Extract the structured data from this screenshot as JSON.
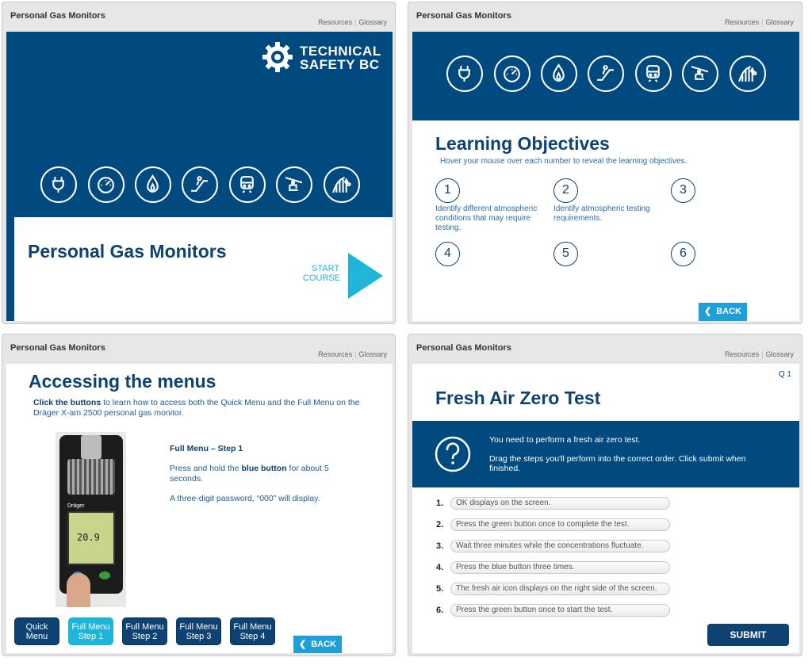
{
  "common": {
    "course_title": "Personal Gas Monitors",
    "resources": "Resources",
    "glossary": "Glossary",
    "separator": "|"
  },
  "panel1": {
    "logo_line1": "TECHNICAL",
    "logo_line2": "SAFETY BC",
    "heading": "Personal Gas Monitors",
    "start_line1": "START",
    "start_line2": "COURSE"
  },
  "icons": [
    "electrical-plug-icon",
    "pressure-gauge-icon",
    "gas-flame-icon",
    "escalator-icon",
    "railway-icon",
    "ski-lift-icon",
    "amusement-ride-icon"
  ],
  "panel2": {
    "heading": "Learning Objectives",
    "instructions": "Hover your mouse over each number to reveal the learning objectives.",
    "objectives": [
      {
        "num": "1",
        "text": "Identify different atmospheric conditions that may require testing."
      },
      {
        "num": "2",
        "text": "Identify atmospheric testing requirements."
      },
      {
        "num": "3",
        "text": ""
      },
      {
        "num": "4",
        "text": ""
      },
      {
        "num": "5",
        "text": ""
      },
      {
        "num": "6",
        "text": ""
      }
    ],
    "back_label": "BACK"
  },
  "panel3": {
    "heading": "Accessing the menus",
    "intro_bold": "Click the buttons",
    "intro_rest": " to learn how to access both the Quick Menu and the Full Menu on the Dräger X-am 2500 personal gas monitor.",
    "step_title": "Full Menu – Step 1",
    "step_p1_a": "Press and hold the ",
    "step_p1_bold": "blue button",
    "step_p1_b": " for about 5 seconds.",
    "step_p2": "A three-digit password, “000” will display.",
    "device_reading": "20.9",
    "device_brand": "Dräger",
    "buttons": [
      {
        "line1": "Quick",
        "line2": "Menu"
      },
      {
        "line1": "Full Menu",
        "line2": "Step 1"
      },
      {
        "line1": "Full Menu",
        "line2": "Step 2"
      },
      {
        "line1": "Full Menu",
        "line2": "Step 3"
      },
      {
        "line1": "Full Menu",
        "line2": "Step 4"
      }
    ],
    "back_label": "BACK"
  },
  "panel4": {
    "question_num": "Q 1",
    "heading": "Fresh Air Zero Test",
    "prompt1": "You need to perform a fresh air zero test.",
    "prompt2": "Drag the steps you'll perform into the correct order. Click submit when finished.",
    "steps": [
      {
        "num": "1.",
        "text": "OK displays on the screen."
      },
      {
        "num": "2.",
        "text": "Press the green button once to complete the test."
      },
      {
        "num": "3.",
        "text": "Wait three minutes while the concentrations fluctuate."
      },
      {
        "num": "4.",
        "text": "Press the blue button three times."
      },
      {
        "num": "5.",
        "text": "The fresh air icon displays on the right side of the screen."
      },
      {
        "num": "6.",
        "text": "Press the green button once to start the test."
      }
    ],
    "submit_label": "SUBMIT"
  },
  "colors": {
    "navy": "#004a7f",
    "heading_blue": "#0d4272",
    "accent_cyan": "#1fb5d8",
    "back_blue": "#1e9fd8"
  }
}
